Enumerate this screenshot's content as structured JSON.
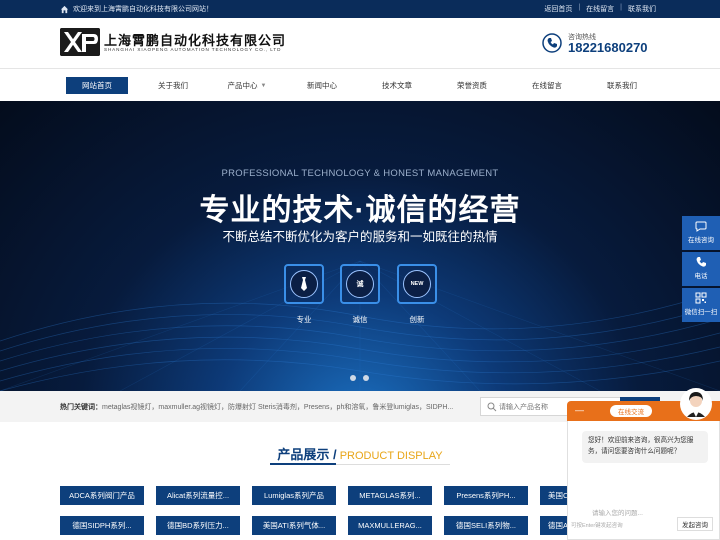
{
  "topbar": {
    "welcome": "欢迎来到上海霄鹏自动化科技有限公司网站！",
    "links": [
      "返回首页",
      "在线留言",
      "联系我们"
    ]
  },
  "header": {
    "company_cn": "上海霄鹏自动化科技有限公司",
    "company_en": "SHANGHAI XIAOPENG AUTOMATION TECHNOLOGY CO., LTD",
    "hotline_label": "咨询热线",
    "hotline_number": "18221680270"
  },
  "nav": {
    "items": [
      {
        "label": "网站首页",
        "active": true
      },
      {
        "label": "关于我们"
      },
      {
        "label": "产品中心",
        "has_dropdown": true
      },
      {
        "label": "新闻中心"
      },
      {
        "label": "技术文章"
      },
      {
        "label": "荣誉资质"
      },
      {
        "label": "在线留言"
      },
      {
        "label": "联系我们"
      }
    ]
  },
  "banner": {
    "tagline_en": "PROFESSIONAL TECHNOLOGY & HONEST MANAGEMENT",
    "title": "专业的技术·诚信的经营",
    "subtitle": "不断总结不断优化为客户的服务和一如既往的热情",
    "features": [
      {
        "label": "专业",
        "icon": "tie-icon"
      },
      {
        "label": "诚信",
        "icon": "medal-icon",
        "glyph": "诚"
      },
      {
        "label": "创新",
        "icon": "new-badge-icon",
        "glyph": "NEW"
      }
    ],
    "slide_count": 2
  },
  "hot": {
    "label": "热门关键词：",
    "keywords": "metaglas视镜灯，maxmuller.ag视镜灯，防爆射灯 Steris消毒剂，Presens，ph和溶氧，鲁米登lumiglas，SIDPH..."
  },
  "search": {
    "placeholder": "请输入产品名称"
  },
  "products": {
    "title_cn": "产品展示 /",
    "title_en": " PRODUCT DISPLAY",
    "row1": [
      "ADCA系列阀门产品",
      "Alicat系列流量控...",
      "Lumiglas系列产品",
      "METAGLAS系列...",
      "Presens系列PH...",
      "美国C..."
    ],
    "row2": [
      "德国SIDPH系列...",
      "德国BD系列压力...",
      "美国ATI系列气体...",
      "MAXMULLERAG...",
      "德国SELI系列物...",
      "德国A..."
    ]
  },
  "side": {
    "items": [
      {
        "label": "在线咨询",
        "icon": "chat-bubble-icon"
      },
      {
        "label": "电话",
        "icon": "phone-icon"
      },
      {
        "label": "微信扫一扫",
        "icon": "qrcode-icon"
      }
    ]
  },
  "chat": {
    "minimize": "—",
    "title": "在线交流",
    "greeting": "您好！欢迎前来咨询，很高兴为您服务，请问您要咨询什么问题呢？",
    "input_placeholder": "请输入您的问题...",
    "hint": "可按Enter键发起咨询",
    "send": "发起咨询"
  },
  "colors": {
    "brand": "#0d3f7c",
    "topbar": "#0a2c5a",
    "accent": "#e8a517",
    "chat": "#e8701a",
    "side": "#1f5fb4"
  }
}
